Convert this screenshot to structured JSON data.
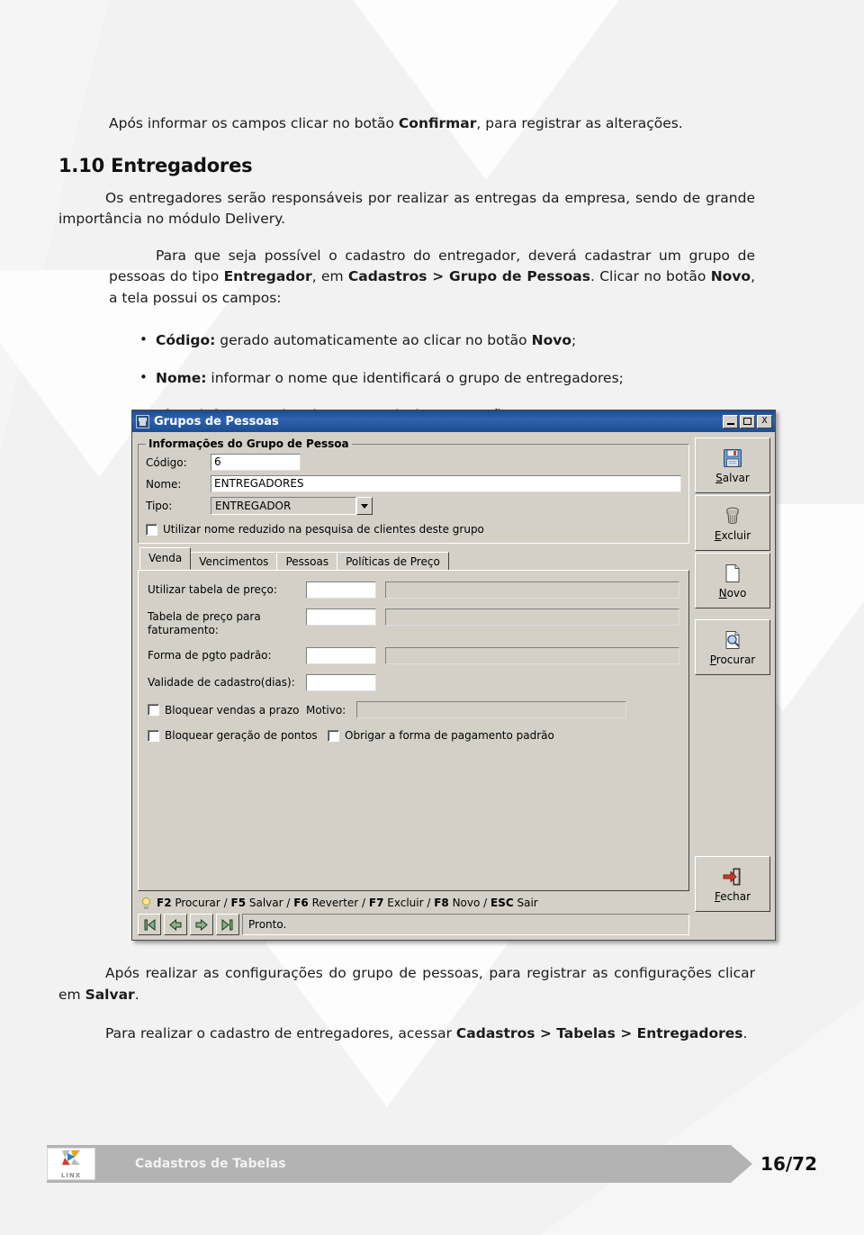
{
  "document": {
    "intro_paragraph_html": "Após informar os campos clicar no botão <b>Confirmar</b>, para registrar as alterações.",
    "heading": "1.10 Entregadores",
    "p1": "Os entregadores serão responsáveis por realizar as entregas da empresa, sendo de grande importância no módulo Delivery.",
    "p2_html": "Para que seja possível o cadastro do entregador, deverá cadastrar um grupo de pessoas do tipo <b>Entregador</b>, em <b>Cadastros &gt; Grupo de Pessoas</b>. Clicar no botão <b>Novo</b>, a tela possui os campos:",
    "bullets": [
      "<b>Código:</b> gerado automaticamente ao clicar no botão <b>Novo</b>;",
      "<b>Nome:</b> informar o nome que identificará o grupo de entregadores;",
      "<b>Tipo:</b> informar o tipo de grupo, selecionar a opção <b>ENTREGADOR</b>."
    ],
    "p3_html": "Após realizar as configurações do grupo de pessoas, para registrar as configurações clicar em <b>Salvar</b>.",
    "p4_html": "Para realizar o cadastro de entregadores, acessar <b>Cadastros &gt; Tabelas &gt; Entregadores</b>."
  },
  "app_window": {
    "title": "Grupos de Pessoas",
    "window_controls": {
      "minimize": "_",
      "maximize": "□",
      "close": "X"
    },
    "group_box": {
      "legend": "Informações do Grupo de Pessoa",
      "fields": [
        {
          "label": "Código:",
          "value": "6"
        },
        {
          "label": "Nome:",
          "value": "ENTREGADORES"
        },
        {
          "label": "Tipo:",
          "value": "ENTREGADOR"
        }
      ],
      "checkbox": {
        "label": "Utilizar nome reduzido na pesquisa de clientes deste grupo",
        "checked": false
      }
    },
    "tabs": [
      {
        "label": "Venda",
        "active": true
      },
      {
        "label": "Vencimentos",
        "active": false
      },
      {
        "label": "Pessoas",
        "active": false
      },
      {
        "label": "Políticas de Preço",
        "active": false
      }
    ],
    "tab_venda": {
      "rows": [
        {
          "label": "Utilizar tabela de preço:",
          "code": "",
          "desc": ""
        },
        {
          "label": "Tabela de preço para faturamento:",
          "code": "",
          "desc": ""
        },
        {
          "label": "Forma de pgto padrão:",
          "code": "",
          "desc": ""
        },
        {
          "label": "Validade de cadastro(dias):",
          "code": "",
          "desc": null
        }
      ],
      "checkbox_bloquear_vendas": "Bloquear vendas a prazo",
      "motivo_label": "Motivo:",
      "motivo_value": "",
      "checkbox_bloquear_pontos": "Bloquear geração de pontos",
      "checkbox_obrigar_forma": "Obrigar a forma de pagamento padrão"
    },
    "hint_bar": {
      "items": [
        {
          "key": "F2",
          "action": "Procurar"
        },
        {
          "key": "F5",
          "action": "Salvar"
        },
        {
          "key": "F6",
          "action": "Reverter"
        },
        {
          "key": "F7",
          "action": "Excluir"
        },
        {
          "key": "F8",
          "action": "Novo"
        },
        {
          "key": "ESC",
          "action": "Sair"
        }
      ],
      "separator": " / "
    },
    "status_text": "Pronto.",
    "nav_buttons": [
      "first-record",
      "previous-record",
      "next-record",
      "last-record"
    ],
    "side_buttons": [
      {
        "label": "Salvar",
        "accel": "S",
        "icon": "floppy-disk-icon"
      },
      {
        "label": "Excluir",
        "accel": "E",
        "icon": "trash-can-icon"
      },
      {
        "label": "Novo",
        "accel": "N",
        "icon": "blank-page-icon"
      },
      {
        "label": "Procurar",
        "accel": "P",
        "icon": "page-magnifier-icon"
      }
    ],
    "close_button": {
      "label": "Fechar",
      "accel": "F",
      "icon": "exit-door-icon"
    }
  },
  "footer": {
    "logo_text": "LINX",
    "section": "Cadastros de Tabelas",
    "page": "16/72"
  },
  "colors": {
    "title_bar_blue": "#1d4a8f",
    "window_face": "#d4d0c8",
    "footer_band": "#b3b3b3",
    "page_bg": "#f2f2f2"
  }
}
